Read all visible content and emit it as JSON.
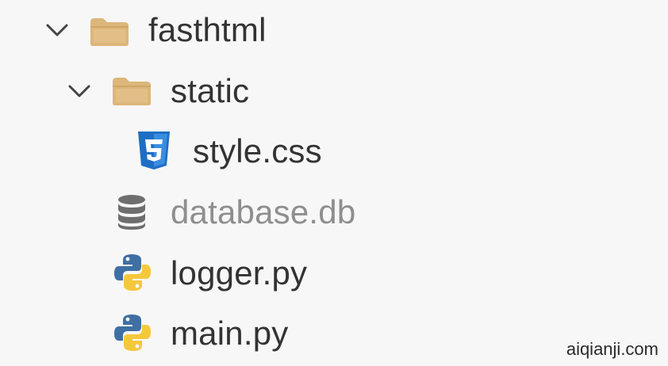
{
  "file_tree": {
    "items": [
      {
        "label": "fasthtml",
        "type": "folder",
        "expanded": true,
        "icon": "folder-icon"
      },
      {
        "label": "static",
        "type": "folder",
        "expanded": true,
        "icon": "folder-icon"
      },
      {
        "label": "style.css",
        "type": "file",
        "icon": "css3-icon"
      },
      {
        "label": "database.db",
        "type": "file",
        "icon": "database-icon",
        "dimmed": true
      },
      {
        "label": "logger.py",
        "type": "file",
        "icon": "python-icon"
      },
      {
        "label": "main.py",
        "type": "file",
        "icon": "python-icon"
      }
    ]
  },
  "watermark": "aiqianji.com",
  "colors": {
    "background": "#f7f7f7",
    "text": "#333333",
    "dimmed_text": "#8e8e8e",
    "folder": "#dcb67a",
    "css_blue": "#1f6ec4",
    "python_blue": "#3f6fa3",
    "python_yellow": "#f5c83b",
    "database": "#6e6e6e"
  }
}
